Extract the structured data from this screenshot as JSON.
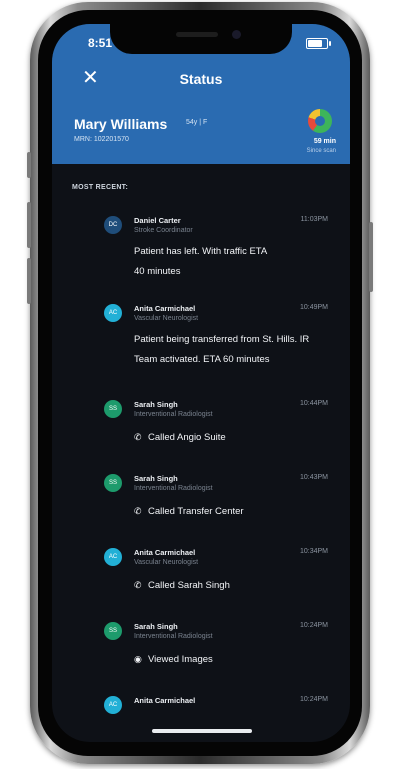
{
  "status_bar": {
    "time": "8:51"
  },
  "nav": {
    "title": "Status"
  },
  "patient": {
    "name": "Mary Williams",
    "demographics": "54y | F",
    "mrn": "MRN: 102201570"
  },
  "timer": {
    "value": "59 min",
    "label": "Since scan"
  },
  "feed": {
    "section_label": "MOST RECENT:",
    "entries": [
      {
        "initials": "DC",
        "avatar_color": "#1f4d7a",
        "name": "Daniel Carter",
        "role": "Stroke Coordinator",
        "time": "11:03PM",
        "message_line1": "Patient has left. With traffic ETA",
        "message_line2": "40 minutes"
      },
      {
        "initials": "AC",
        "avatar_color": "#22b0d6",
        "name": "Anita Carmichael",
        "role": "Vascular Neurologist",
        "time": "10:49PM",
        "message_line1": "Patient being transferred from St. Hills. IR",
        "message_line2": "Team activated. ETA 60 minutes"
      },
      {
        "initials": "SS",
        "avatar_color": "#1d9b6c",
        "name": "Sarah Singh",
        "role": "Interventional Radiologist",
        "time": "10:44PM",
        "action_icon": "phone-icon",
        "action": "Called Angio Suite"
      },
      {
        "initials": "SS",
        "avatar_color": "#1d9b6c",
        "name": "Sarah Singh",
        "role": "Interventional Radiologist",
        "time": "10:43PM",
        "action_icon": "phone-icon",
        "action": "Called Transfer Center"
      },
      {
        "initials": "AC",
        "avatar_color": "#22b0d6",
        "name": "Anita Carmichael",
        "role": "Vascular Neurologist",
        "time": "10:34PM",
        "action_icon": "phone-icon",
        "action": "Called Sarah Singh"
      },
      {
        "initials": "SS",
        "avatar_color": "#1d9b6c",
        "name": "Sarah Singh",
        "role": "Interventional Radiologist",
        "time": "10:24PM",
        "action_icon": "eye-icon",
        "action": "Viewed Images"
      },
      {
        "initials": "AC",
        "avatar_color": "#22b0d6",
        "name": "Anita Carmichael",
        "role": "",
        "time": "10:24PM"
      }
    ]
  }
}
